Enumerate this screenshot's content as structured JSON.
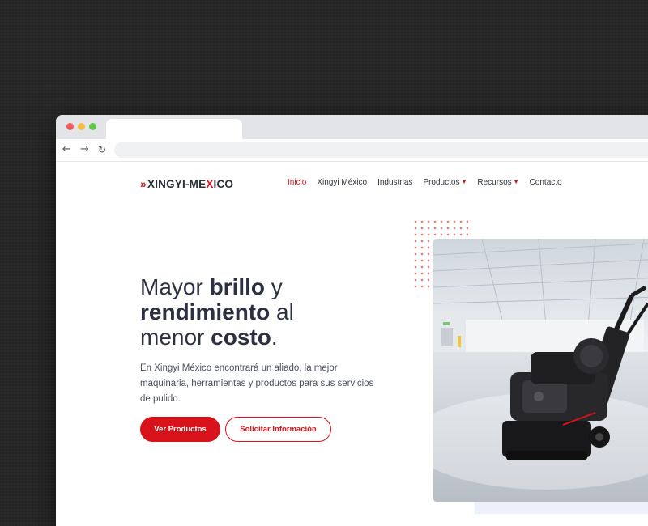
{
  "browser": {
    "back_icon": "arrow-left-icon",
    "forward_icon": "arrow-right-icon",
    "reload_icon": "reload-icon"
  },
  "brand": {
    "logo_prefix": "XINGYI-ME",
    "logo_x": "X",
    "logo_suffix": "ICO",
    "accent_color": "#d8121a"
  },
  "nav": {
    "items": [
      {
        "label": "Inicio",
        "active": true
      },
      {
        "label": "Xingyi México"
      },
      {
        "label": "Industrias"
      },
      {
        "label": "Productos",
        "dropdown": true
      },
      {
        "label": "Recursos",
        "dropdown": true
      },
      {
        "label": "Contacto"
      }
    ]
  },
  "hero": {
    "title_1": "Mayor ",
    "title_1_bold": "brillo",
    "title_1_end": " y",
    "title_2_bold": "rendimiento",
    "title_2_end": " al",
    "title_3": "menor ",
    "title_3_bold": "costo",
    "title_3_end": ".",
    "text": "En Xingyi México encontrará un aliado, la mejor maquinaria, herramientas y productos para sus servicios de pulido.",
    "primary_button": "Ver Productos",
    "secondary_button": "Solicitar Información"
  }
}
